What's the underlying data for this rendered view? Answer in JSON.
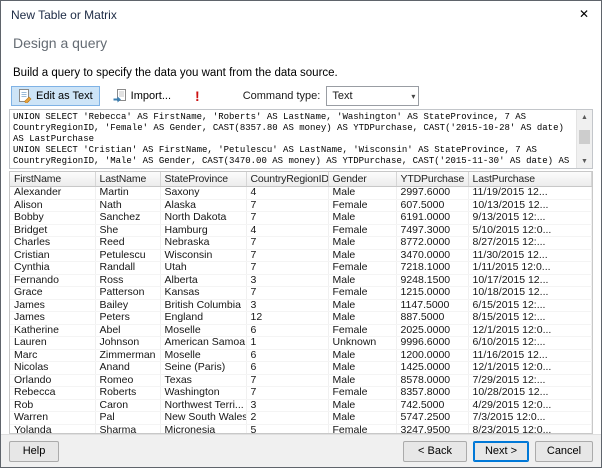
{
  "window": {
    "title": "New Table or Matrix",
    "close_glyph": "✕"
  },
  "header": {
    "title": "Design a query",
    "subtitle": "Build a query to specify the data you want from the data source."
  },
  "toolbar": {
    "edit_as_text_label": "Edit as Text",
    "import_label": "Import...",
    "run_glyph": "!",
    "command_type_label": "Command type:",
    "command_type_value": "Text",
    "combo_arrow": "▾"
  },
  "query": {
    "text": "UNION SELECT 'Rebecca' AS FirstName, 'Roberts' AS LastName, 'Washington' AS StateProvince, 7 AS\nCountryRegionID, 'Female' AS Gender, CAST(8357.80 AS money) AS YTDPurchase, CAST('2015-10-28' AS date)\nAS LastPurchase\nUNION SELECT 'Cristian' AS FirstName, 'Petulescu' AS LastName, 'Wisconsin' AS StateProvince, 7 AS\nCountryRegionID, 'Male' AS Gender, CAST(3470.00 AS money) AS YTDPurchase, CAST('2015-11-30' AS date) AS",
    "scroll_up_glyph": "▲",
    "scroll_down_glyph": "▼"
  },
  "grid": {
    "columns": [
      "FirstName",
      "LastName",
      "StateProvince",
      "CountryRegionID",
      "Gender",
      "YTDPurchase",
      "LastPurchase"
    ],
    "rows": [
      [
        "Alexander",
        "Martin",
        "Saxony",
        "4",
        "Male",
        "2997.6000",
        "11/19/2015 12..."
      ],
      [
        "Alison",
        "Nath",
        "Alaska",
        "7",
        "Female",
        "607.5000",
        "10/13/2015 12..."
      ],
      [
        "Bobby",
        "Sanchez",
        "North Dakota",
        "7",
        "Male",
        "6191.0000",
        "9/13/2015 12:..."
      ],
      [
        "Bridget",
        "She",
        "Hamburg",
        "4",
        "Female",
        "7497.3000",
        "5/10/2015 12:0..."
      ],
      [
        "Charles",
        "Reed",
        "Nebraska",
        "7",
        "Male",
        "8772.0000",
        "8/27/2015 12:..."
      ],
      [
        "Cristian",
        "Petulescu",
        "Wisconsin",
        "7",
        "Male",
        "3470.0000",
        "11/30/2015 12..."
      ],
      [
        "Cynthia",
        "Randall",
        "Utah",
        "7",
        "Female",
        "7218.1000",
        "1/11/2015 12:0..."
      ],
      [
        "Fernando",
        "Ross",
        "Alberta",
        "3",
        "Male",
        "9248.1500",
        "10/17/2015 12..."
      ],
      [
        "Grace",
        "Patterson",
        "Kansas",
        "7",
        "Female",
        "1215.0000",
        "10/18/2015 12..."
      ],
      [
        "James",
        "Bailey",
        "British Columbia",
        "3",
        "Male",
        "1147.5000",
        "6/15/2015 12:..."
      ],
      [
        "James",
        "Peters",
        "England",
        "12",
        "Male",
        "887.5000",
        "8/15/2015 12:..."
      ],
      [
        "Katherine",
        "Abel",
        "Moselle",
        "6",
        "Female",
        "2025.0000",
        "12/1/2015 12:0..."
      ],
      [
        "Lauren",
        "Johnson",
        "American Samoa",
        "1",
        "Unknown",
        "9996.6000",
        "6/10/2015 12:..."
      ],
      [
        "Marc",
        "Zimmerman",
        "Moselle",
        "6",
        "Male",
        "1200.0000",
        "11/16/2015 12..."
      ],
      [
        "Nicolas",
        "Anand",
        "Seine (Paris)",
        "6",
        "Male",
        "1425.0000",
        "12/1/2015 12:0..."
      ],
      [
        "Orlando",
        "Romeo",
        "Texas",
        "7",
        "Male",
        "8578.0000",
        "7/29/2015 12:..."
      ],
      [
        "Rebecca",
        "Roberts",
        "Washington",
        "7",
        "Female",
        "8357.8000",
        "10/28/2015 12..."
      ],
      [
        "Rob",
        "Caron",
        "Northwest Terri...",
        "3",
        "Male",
        "742.5000",
        "4/29/2015 12:0..."
      ],
      [
        "Warren",
        "Pal",
        "New South Wales",
        "2",
        "Male",
        "5747.2500",
        "7/3/2015 12:0..."
      ],
      [
        "Yolanda",
        "Sharma",
        "Micronesia",
        "5",
        "Female",
        "3247.9500",
        "8/23/2015 12:0..."
      ]
    ]
  },
  "footer": {
    "help_label": "Help",
    "back_label": "< Back",
    "next_label": "Next >",
    "cancel_label": "Cancel"
  },
  "colors": {
    "accent": "#0078d7",
    "run_icon_red": "#cc1111",
    "toggle_bg": "#cde4f7",
    "toggle_border": "#7fb2e5"
  }
}
